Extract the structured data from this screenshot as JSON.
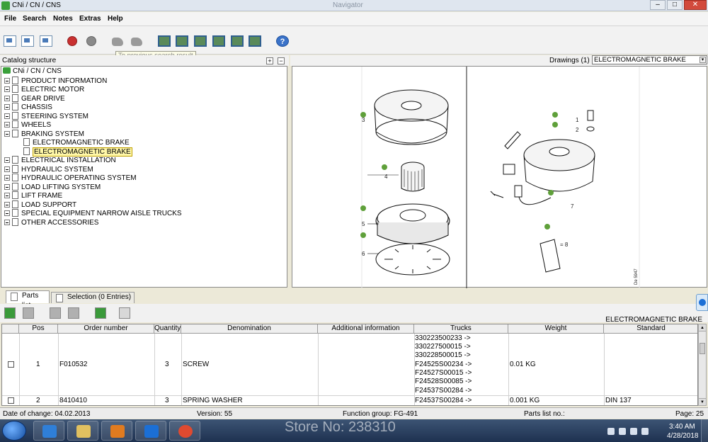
{
  "window": {
    "title": "CNi / CN / CNS",
    "center_title": "Navigator"
  },
  "window_controls": {
    "minimize": "–",
    "maximize": "□",
    "close": "✕"
  },
  "menu": [
    "File",
    "Search",
    "Notes",
    "Extras",
    "Help"
  ],
  "toolbar": {
    "tooltip": "To previous search result",
    "icons": [
      "page-back-icon",
      "page-home-icon",
      "page-forward-icon",
      "stop-icon",
      "gear-icon",
      "hand-left-icon",
      "hand-right-icon",
      "image-1-icon",
      "image-2-icon",
      "image-3-icon",
      "image-4-icon",
      "image-5-icon",
      "image-6-icon",
      "help-icon"
    ],
    "help_symbol": "?"
  },
  "catalog": {
    "header": "Catalog structure",
    "expand_symbol": "+",
    "collapse_symbol": "−",
    "root": "CNi / CN / CNS",
    "items": [
      {
        "label": "PRODUCT INFORMATION"
      },
      {
        "label": "ELECTRIC MOTOR"
      },
      {
        "label": "GEAR DRIVE"
      },
      {
        "label": "CHASSIS"
      },
      {
        "label": "STEERING SYSTEM"
      },
      {
        "label": "WHEELS"
      },
      {
        "label": "BRAKING SYSTEM"
      },
      {
        "label": "ELECTROMAGNETIC BRAKE"
      },
      {
        "label": "ELECTROMAGNETIC BRAKE"
      },
      {
        "label": "ELECTRICAL INSTALLATION"
      },
      {
        "label": "HYDRAULIC SYSTEM"
      },
      {
        "label": "HYDRAULIC OPERATING SYSTEM"
      },
      {
        "label": "LOAD LIFTING SYSTEM"
      },
      {
        "label": "LIFT FRAME"
      },
      {
        "label": "LOAD SUPPORT"
      },
      {
        "label": "SPECIAL EQUIPMENT NARROW AISLE TRUCKS"
      },
      {
        "label": "OTHER ACCESSORIES"
      }
    ]
  },
  "drawings": {
    "label": "Drawings (1)",
    "selected": "ELECTROMAGNETIC BRAKE",
    "arrow": "▾",
    "callouts": {
      "left": [
        "3",
        "4",
        "5",
        "6"
      ],
      "right": [
        "1",
        "2",
        "7",
        "= 8"
      ],
      "code": "De 5947"
    }
  },
  "tabs": [
    "Parts list",
    "Selection (0 Entries)"
  ],
  "parts_heading": "ELECTROMAGNETIC BRAKE",
  "parts_table": {
    "columns": [
      "Pos",
      "Order number",
      "Quantity",
      "Denomination",
      "Additional information",
      "Trucks",
      "Weight",
      "Standard"
    ],
    "rows": [
      {
        "pos": "1",
        "order": "F010532",
        "qty": "3",
        "denomination": "SCREW",
        "additional": "",
        "trucks": [
          "330223500233 ->",
          "330227500015 ->",
          "330228500015 ->",
          "F24525S00234 ->",
          "F24527S00015 ->",
          "F24528S00085 ->",
          "F24537S00284 ->"
        ],
        "weight": "0.01 KG",
        "standard": ""
      },
      {
        "pos": "2",
        "order": "8410410",
        "qty": "3",
        "denomination": "SPRING WASHER",
        "additional": "",
        "trucks": [
          "F24537S00284 ->"
        ],
        "weight": "0.001 KG",
        "standard": "DIN 137"
      }
    ]
  },
  "status": {
    "date_of_change": "Date of change: 04.02.2013",
    "version": "Version: 55",
    "function_group": "Function group: FG-491",
    "parts_list_no": "Parts list no.:",
    "page": "Page: 25"
  },
  "taskbar": {
    "watermark": "Store No: 238310",
    "time": "3:40 AM",
    "date": "4/28/2018"
  }
}
